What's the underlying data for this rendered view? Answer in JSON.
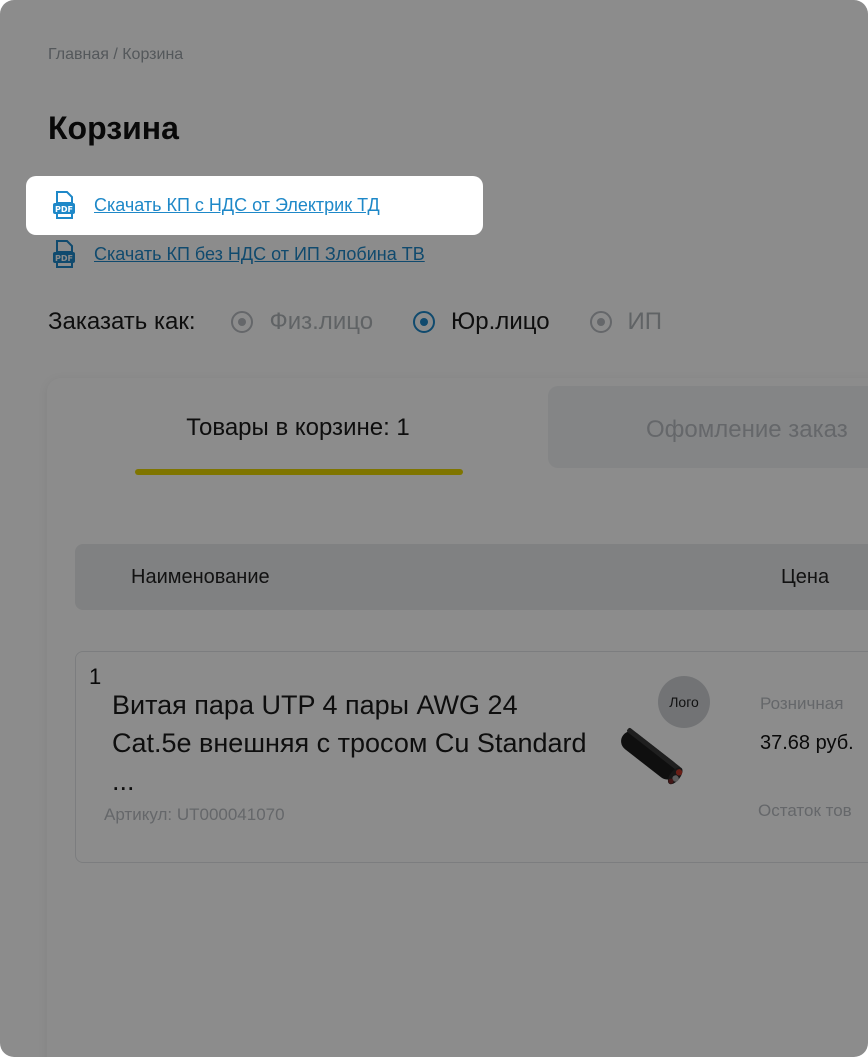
{
  "breadcrumb": "Главная / Корзина",
  "page_title": "Корзина",
  "downloads": [
    {
      "icon": "pdf-file-icon",
      "label": "Скачать КП с НДС от Электрик ТД"
    },
    {
      "icon": "pdf-file-icon",
      "label": "Скачать КП без НДС от ИП Злобина ТВ"
    }
  ],
  "order_as": {
    "label": "Заказать как:",
    "options": [
      {
        "label": "Физ.лицо",
        "selected": false
      },
      {
        "label": "Юр.лицо",
        "selected": true
      },
      {
        "label": "ИП",
        "selected": false
      }
    ]
  },
  "tabs": [
    {
      "label": "Товары в корзине: 1",
      "active": true
    },
    {
      "label": "Офомление заказ",
      "active": false
    }
  ],
  "table": {
    "headers": {
      "name": "Наименование",
      "price": "Цена"
    }
  },
  "items": [
    {
      "index": "1",
      "title": "Витая пара UTP 4 пары AWG 24 Cat.5e внешняя с тросом Cu Standard ...",
      "sku": "Артикул: UT000041070",
      "logo": "Лого",
      "price_label": "Розничная",
      "price": "37.68 руб.",
      "stock_label": "Остаток тов"
    }
  ],
  "colors": {
    "link": "#1e88c8",
    "accent_underline": "#e8d600",
    "overlay": "rgba(0,0,0,0.45)",
    "muted": "#b8bcc1"
  }
}
